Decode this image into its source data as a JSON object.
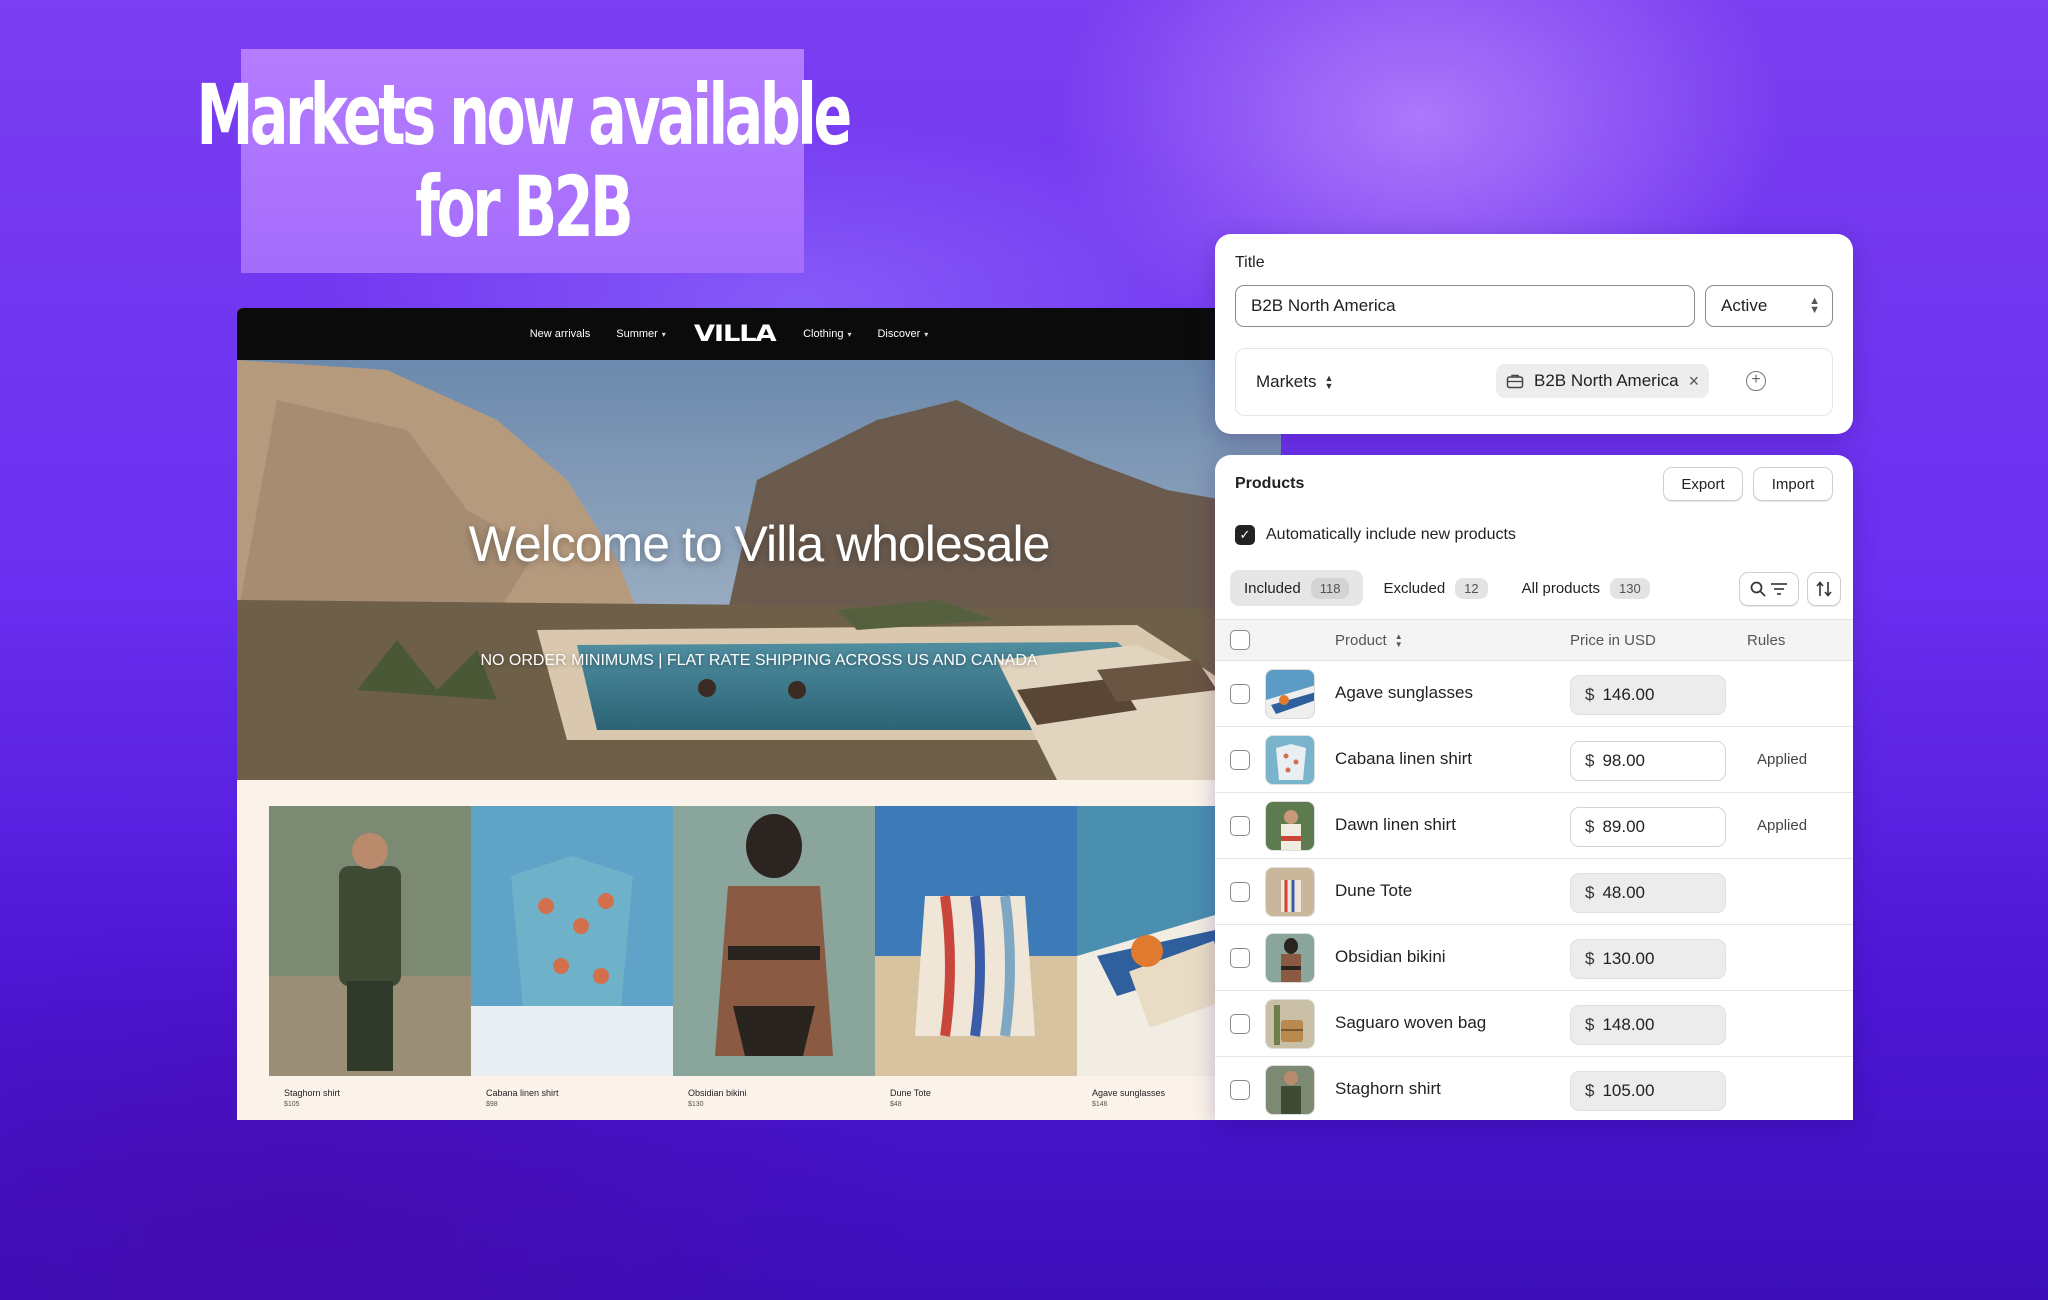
{
  "headline": {
    "line1": "Markets now available",
    "line2": "for B2B"
  },
  "storefront": {
    "nav": {
      "links": [
        "New arrivals",
        "Summer",
        "Clothing",
        "Discover"
      ],
      "logo": "VILLA"
    },
    "hero_title": "Welcome to Villa wholesale",
    "hero_subtitle": "NO ORDER MINIMUMS | FLAT RATE SHIPPING ACROSS US AND CANADA",
    "products": [
      {
        "name": "Staghorn shirt",
        "price": "$105"
      },
      {
        "name": "Cabana linen shirt",
        "price": "$98"
      },
      {
        "name": "Obsidian bikini",
        "price": "$130"
      },
      {
        "name": "Dune Tote",
        "price": "$48"
      },
      {
        "name": "Agave sunglasses",
        "price": "$146"
      }
    ]
  },
  "title_card": {
    "title_label": "Title",
    "title_value": "B2B North America",
    "status": "Active",
    "markets_label": "Markets",
    "market_chip": "B2B North America"
  },
  "products_card": {
    "header": "Products",
    "export_label": "Export",
    "import_label": "Import",
    "auto_include_label": "Automatically include new products",
    "tabs": [
      {
        "label": "Included",
        "count": "118"
      },
      {
        "label": "Excluded",
        "count": "12"
      },
      {
        "label": "All products",
        "count": "130"
      }
    ],
    "columns": {
      "product": "Product",
      "price": "Price in USD",
      "rules": "Rules"
    },
    "currency": "$",
    "rows": [
      {
        "name": "Agave sunglasses",
        "price": "146.00",
        "rule": ""
      },
      {
        "name": "Cabana linen shirt",
        "price": "98.00",
        "rule": "Applied"
      },
      {
        "name": "Dawn linen shirt",
        "price": "89.00",
        "rule": "Applied"
      },
      {
        "name": "Dune Tote",
        "price": "48.00",
        "rule": ""
      },
      {
        "name": "Obsidian bikini",
        "price": "130.00",
        "rule": ""
      },
      {
        "name": "Saguaro woven bag",
        "price": "148.00",
        "rule": ""
      },
      {
        "name": "Staghorn shirt",
        "price": "105.00",
        "rule": ""
      }
    ]
  }
}
